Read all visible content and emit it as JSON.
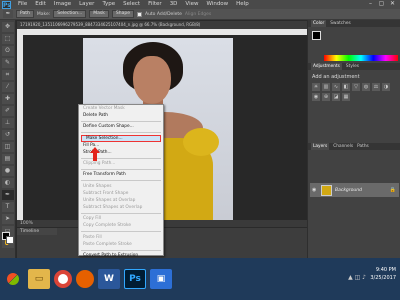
{
  "menubar": {
    "logo": "Ps",
    "items": [
      "File",
      "Edit",
      "Image",
      "Layer",
      "Type",
      "Select",
      "Filter",
      "3D",
      "View",
      "Window",
      "Help"
    ],
    "controls": [
      "–",
      "▢",
      "✕"
    ]
  },
  "options": {
    "mode": "Path",
    "make_label": "Make:",
    "selection_btn": "Selection...",
    "mask_btn": "Mask",
    "shape_btn": "Shape",
    "auto_add_label": "Auto Add/Delete",
    "align_label": "Align Edges"
  },
  "document": {
    "tab_title": "17191920_1351106996279539_8847334625107404_n.jpg @ 66.7% (Background, RGB/8)",
    "zoom_status": "100%"
  },
  "timeline": {
    "title": "Timeline"
  },
  "context_menu": {
    "items": [
      {
        "label": "Create Vector Mask",
        "disabled": true
      },
      {
        "label": "Delete Path",
        "disabled": false
      },
      {
        "sep": true
      },
      {
        "label": "Define Custom Shape...",
        "disabled": false
      },
      {
        "sep": true
      },
      {
        "label": "Make Selection...",
        "disabled": false,
        "highlight": true
      },
      {
        "label": "Fill Pa...",
        "disabled": false
      },
      {
        "label": "Stroke Path...",
        "disabled": false
      },
      {
        "sep": true
      },
      {
        "label": "Clipping Path...",
        "disabled": true
      },
      {
        "sep": true
      },
      {
        "label": "Free Transform Path",
        "disabled": false
      },
      {
        "sep": true
      },
      {
        "label": "Unite Shapes",
        "disabled": true
      },
      {
        "label": "Subtract Front Shape",
        "disabled": true
      },
      {
        "label": "Unite Shapes at Overlap",
        "disabled": true
      },
      {
        "label": "Subtract Shapes at Overlap",
        "disabled": true
      },
      {
        "sep": true
      },
      {
        "label": "Copy Fill",
        "disabled": true
      },
      {
        "label": "Copy Complete Stroke",
        "disabled": true
      },
      {
        "sep": true
      },
      {
        "label": "Paste Fill",
        "disabled": true
      },
      {
        "label": "Paste Complete Stroke",
        "disabled": true
      },
      {
        "sep": true
      },
      {
        "label": "Convert Path to Extrusion",
        "disabled": false
      },
      {
        "label": "Create Constraint(s) From Path",
        "disabled": true
      }
    ]
  },
  "right_dock": {
    "color_tabs": [
      "Color",
      "Swatches"
    ],
    "adjust_tabs": [
      "Adjustments",
      "Styles"
    ],
    "adjust_title": "Add an adjustment",
    "layer_tabs": [
      "Layers",
      "Channels",
      "Paths"
    ],
    "layer_name": "Background"
  },
  "taskbar": {
    "time": "9:40 PM",
    "date": "3/25/2017"
  }
}
